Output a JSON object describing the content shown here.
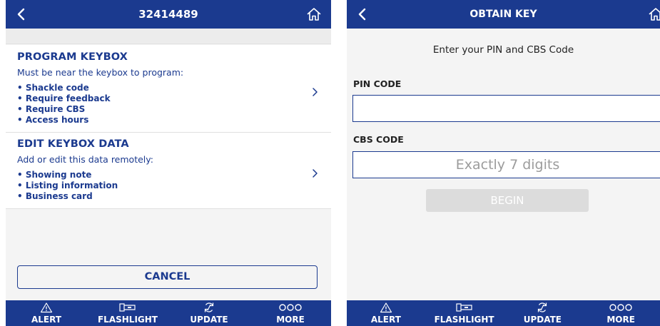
{
  "left_screen": {
    "header": {
      "title": "32414489",
      "back_icon": "chevron-left-icon",
      "home_icon": "home-icon"
    },
    "cards": [
      {
        "title": "PROGRAM KEYBOX",
        "subtitle": "Must be near the keybox to program:",
        "bullets": [
          "• Shackle code",
          "• Require feedback",
          "• Require CBS",
          "• Access hours"
        ]
      },
      {
        "title": "EDIT KEYBOX DATA",
        "subtitle": "Add or edit this data remotely:",
        "bullets": [
          "• Showing note",
          "• Listing information",
          "• Business card"
        ]
      }
    ],
    "cancel_label": "CANCEL"
  },
  "right_screen": {
    "header": {
      "title": "OBTAIN KEY",
      "back_icon": "chevron-left-icon",
      "home_icon": "home-icon"
    },
    "prompt": "Enter your PIN and CBS Code",
    "pin_label": "PIN CODE",
    "pin_value": "",
    "pin_placeholder": "",
    "cbs_label": "CBS CODE",
    "cbs_value": "",
    "cbs_placeholder": "Exactly 7 digits",
    "begin_label": "BEGIN"
  },
  "tabbar": [
    {
      "label": "ALERT",
      "icon": "alert-triangle-icon"
    },
    {
      "label": "FLASHLIGHT",
      "icon": "flashlight-icon"
    },
    {
      "label": "UPDATE",
      "icon": "sync-icon"
    },
    {
      "label": "MORE",
      "icon": "more-dots-icon"
    }
  ],
  "colors": {
    "brand_blue": "#1b3a8f",
    "screen_background": "#f4f4f4",
    "disabled_button": "#dcdcdc"
  }
}
